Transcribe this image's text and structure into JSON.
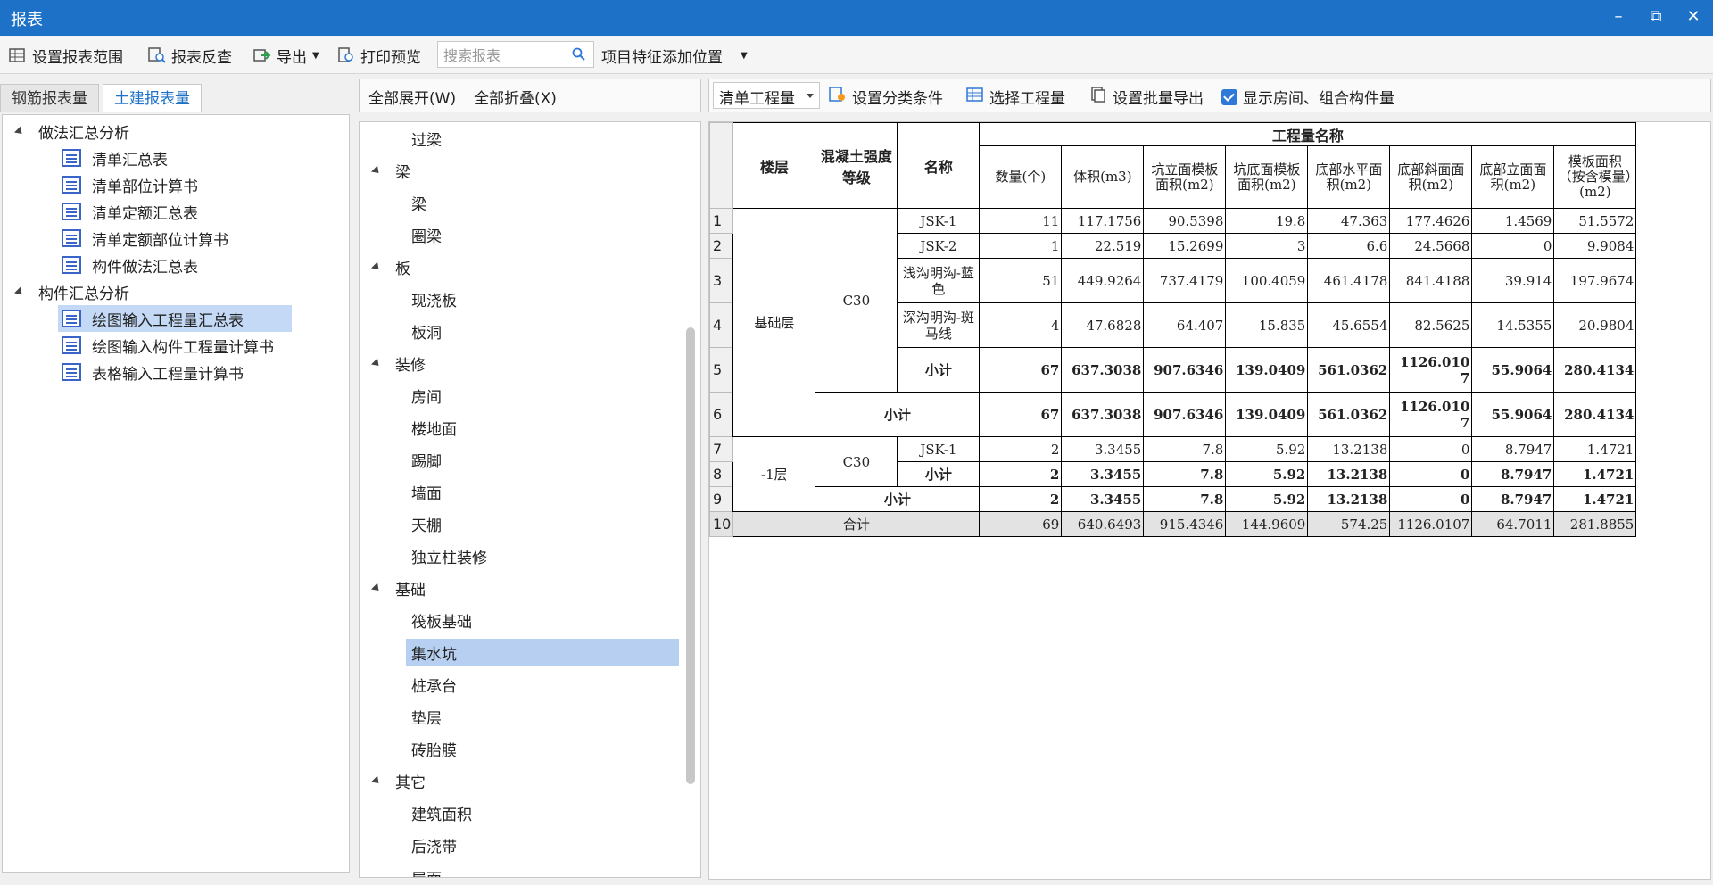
{
  "window": {
    "title": "报表",
    "minimize": "–",
    "restore": "⧉",
    "close": "✕"
  },
  "toolbar": {
    "set_range": "设置报表范围",
    "reverse_check": "报表反查",
    "export": "导出",
    "print_preview": "打印预览",
    "search_placeholder": "搜索报表",
    "feature_pos": "项目特征添加位置"
  },
  "left_tabs": [
    "钢筋报表量",
    "土建报表量"
  ],
  "left_tree": {
    "group1": "做法汇总分析",
    "group1_items": [
      "清单汇总表",
      "清单部位计算书",
      "清单定额汇总表",
      "清单定额部位计算书",
      "构件做法汇总表"
    ],
    "group2": "构件汇总分析",
    "group2_items": [
      "绘图输入工程量汇总表",
      "绘图输入构件工程量计算书",
      "表格输入工程量计算书"
    ]
  },
  "mid": {
    "expand_all": "全部展开(W)",
    "collapse_all": "全部折叠(X)",
    "nodes": [
      {
        "label": "过梁",
        "level": 2
      },
      {
        "label": "梁",
        "level": 1
      },
      {
        "label": "梁",
        "level": 2
      },
      {
        "label": "圈梁",
        "level": 2
      },
      {
        "label": "板",
        "level": 1
      },
      {
        "label": "现浇板",
        "level": 2
      },
      {
        "label": "板洞",
        "level": 2
      },
      {
        "label": "装修",
        "level": 1
      },
      {
        "label": "房间",
        "level": 2
      },
      {
        "label": "楼地面",
        "level": 2
      },
      {
        "label": "踢脚",
        "level": 2
      },
      {
        "label": "墙面",
        "level": 2
      },
      {
        "label": "天棚",
        "level": 2
      },
      {
        "label": "独立柱装修",
        "level": 2
      },
      {
        "label": "基础",
        "level": 1
      },
      {
        "label": "筏板基础",
        "level": 2
      },
      {
        "label": "集水坑",
        "level": 2
      },
      {
        "label": "桩承台",
        "level": 2
      },
      {
        "label": "垫层",
        "level": 2
      },
      {
        "label": "砖胎膜",
        "level": 2
      },
      {
        "label": "其它",
        "level": 1
      },
      {
        "label": "建筑面积",
        "level": 2
      },
      {
        "label": "后浇带",
        "level": 2
      },
      {
        "label": "屋面",
        "level": 2
      }
    ]
  },
  "right_bar": {
    "combo_value": "清单工程量",
    "set_category": "设置分类条件",
    "select_quantity": "选择工程量",
    "batch_export": "设置批量导出",
    "show_rooms": "显示房间、组合构件量"
  },
  "report": {
    "header": {
      "floor": "楼层",
      "grade": "混凝土强度等级",
      "name": "名称",
      "group": "工程量名称",
      "cols": [
        "数量(个)",
        "体积(m3)",
        "坑立面模板面积(m2)",
        "坑底面模板面积(m2)",
        "底部水平面积(m2)",
        "底部斜面面积(m2)",
        "底部立面面积(m2)",
        "模板面积（按含模量）(m2)"
      ]
    },
    "floor1": "基础层",
    "floor2": "-1层",
    "grade": "C30",
    "rows": [
      {
        "n": "1",
        "name": "JSK-1",
        "v": [
          "11",
          "117.1756",
          "90.5398",
          "19.8",
          "47.363",
          "177.4626",
          "1.4569",
          "51.5572"
        ]
      },
      {
        "n": "2",
        "name": "JSK-2",
        "v": [
          "1",
          "22.519",
          "15.2699",
          "3",
          "6.6",
          "24.5668",
          "0",
          "9.9084"
        ]
      },
      {
        "n": "3",
        "name": "浅沟明沟-蓝色",
        "v": [
          "51",
          "449.9264",
          "737.4179",
          "100.4059",
          "461.4178",
          "841.4188",
          "39.914",
          "197.9674"
        ]
      },
      {
        "n": "4",
        "name": "深沟明沟-斑马线",
        "v": [
          "4",
          "47.6828",
          "64.407",
          "15.835",
          "45.6554",
          "82.5625",
          "14.5355",
          "20.9804"
        ]
      },
      {
        "n": "5",
        "name": "小计",
        "v": [
          "67",
          "637.3038",
          "907.6346",
          "139.0409",
          "561.0362",
          "1126.0107",
          "55.9064",
          "280.4134"
        ]
      },
      {
        "n": "6",
        "name": "小计",
        "v": [
          "67",
          "637.3038",
          "907.6346",
          "139.0409",
          "561.0362",
          "1126.0107",
          "55.9064",
          "280.4134"
        ]
      },
      {
        "n": "7",
        "name": "JSK-1",
        "v": [
          "2",
          "3.3455",
          "7.8",
          "5.92",
          "13.2138",
          "0",
          "8.7947",
          "1.4721"
        ]
      },
      {
        "n": "8",
        "name": "小计",
        "v": [
          "2",
          "3.3455",
          "7.8",
          "5.92",
          "13.2138",
          "0",
          "8.7947",
          "1.4721"
        ]
      },
      {
        "n": "9",
        "name": "小计",
        "v": [
          "2",
          "3.3455",
          "7.8",
          "5.92",
          "13.2138",
          "0",
          "8.7947",
          "1.4721"
        ]
      },
      {
        "n": "10",
        "name": "合计",
        "v": [
          "69",
          "640.6493",
          "915.4346",
          "144.9609",
          "574.25",
          "1126.0107",
          "64.7011",
          "281.8855"
        ]
      }
    ]
  }
}
